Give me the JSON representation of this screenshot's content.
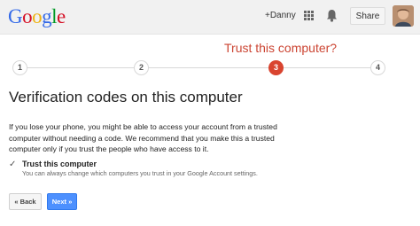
{
  "header": {
    "logo": {
      "letters": [
        "G",
        "o",
        "o",
        "g",
        "l",
        "e"
      ],
      "colors": [
        "#3369e8",
        "#d50f25",
        "#eeb211",
        "#3369e8",
        "#009925",
        "#d50f25"
      ]
    },
    "user_link": "+Danny",
    "apps_icon": "apps-grid-icon",
    "notifications_icon": "bell-icon",
    "share_label": "Share",
    "avatar": "user-avatar"
  },
  "stepper": {
    "caption": "Trust this computer?",
    "steps": [
      "1",
      "2",
      "3",
      "4"
    ],
    "active_index": 2,
    "active_color": "#d9442f"
  },
  "main": {
    "title": "Verification codes on this computer",
    "paragraph_lines": [
      "If you lose your phone, you might be able to access your account from a trusted",
      "computer without needing a code. We recommend that you make this a trusted",
      "computer only if you trust the people who have access to it."
    ],
    "trust": {
      "checked": true,
      "check_glyph": "✓",
      "label": "Trust this computer",
      "help": "You can always change which computers you trust in your Google Account settings."
    },
    "buttons": {
      "back": "« Back",
      "next": "Next »"
    }
  }
}
